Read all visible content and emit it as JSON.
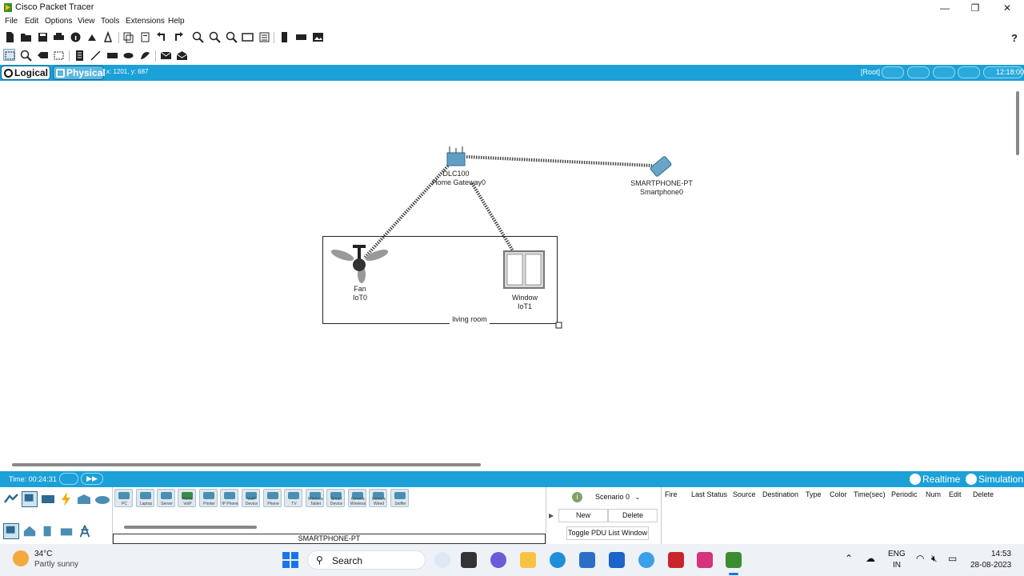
{
  "window": {
    "title": "Cisco Packet Tracer",
    "controls": {
      "minimize": "—",
      "maximize": "❐",
      "close": "✕"
    }
  },
  "menu": [
    "File",
    "Edit",
    "Options",
    "View",
    "Tools",
    "Extensions",
    "Help"
  ],
  "workspace": {
    "logical_label": "Logical",
    "physical_label": "Physical",
    "coords": "x: 1201, y: 687",
    "root_label": "[Root]",
    "clock": "12:18:00"
  },
  "canvas": {
    "gateway": {
      "model": "DLC100",
      "name": "Home Gateway0"
    },
    "smartphone": {
      "model": "SMARTPHONE-PT",
      "name": "Smartphone0"
    },
    "fan": {
      "model": "Fan",
      "name": "IoT0"
    },
    "window_dev": {
      "model": "Window",
      "name": "IoT1"
    },
    "cluster_label": "living room"
  },
  "timebar": {
    "time": "Time: 00:24:31",
    "realtime": "Realtime",
    "simulation": "Simulation"
  },
  "device_tiles": [
    "PC",
    "Laptop",
    "Server",
    "Home VoIP",
    "Printer",
    "IP Phone",
    "VoIP Device",
    "Phone",
    "TV",
    "Wireless Tablet",
    "Smart Device",
    "Generic Wireless",
    "Generic Wired",
    "Sniffer"
  ],
  "selected_device": "SMARTPHONE-PT",
  "scenario": {
    "select_value": "Scenario 0",
    "new_label": "New",
    "delete_label": "Delete",
    "toggle_label": "Toggle PDU List Window"
  },
  "pdu_columns": [
    "Fire",
    "Last Status",
    "Source",
    "Destination",
    "Type",
    "Color",
    "Time(sec)",
    "Periodic",
    "Num",
    "Edit",
    "Delete"
  ],
  "taskbar": {
    "temperature": "34°C",
    "weather": "Partly sunny",
    "search_label": "Search",
    "lang_top": "ENG",
    "lang_bottom": "IN",
    "time": "14:53",
    "date": "28-08-2023"
  },
  "colors": {
    "accent": "#1ba1d8",
    "link_line": "#555555"
  }
}
